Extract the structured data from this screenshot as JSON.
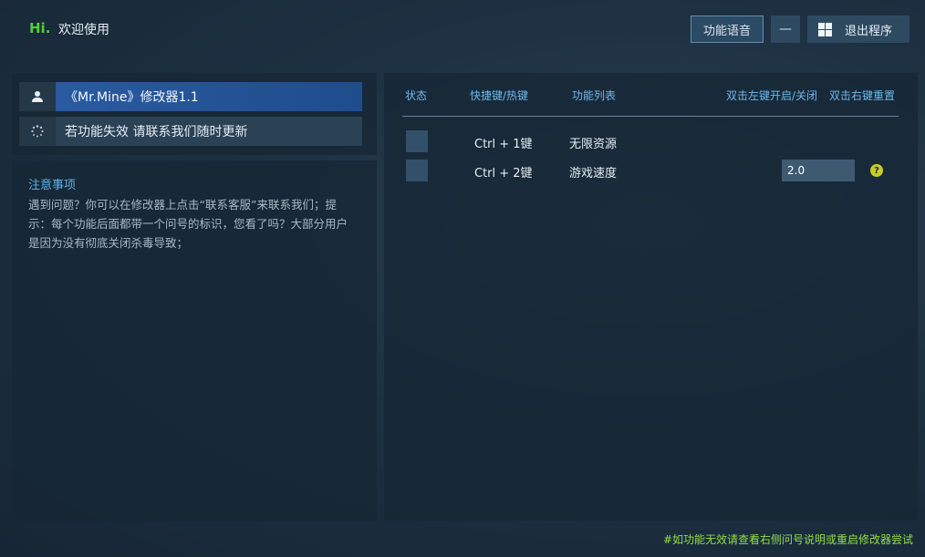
{
  "header": {
    "hi": "Hi.",
    "welcome": "欢迎使用",
    "voice_button": "功能语音",
    "minimize_label": "—",
    "exit_button": "退出程序"
  },
  "left_panel": {
    "game_title": "《Mr.Mine》修改器1.1",
    "status_message": "若功能失效  请联系我们随时更新",
    "notice_title": "注意事项",
    "notice_body": "遇到问题？你可以在修改器上点击“联系客服”来联系我们；提示：每个功能后面都带一个问号的标识，您看了吗？大部分用户是因为没有彻底关闭杀毒导致；"
  },
  "table": {
    "headers": {
      "status": "状态",
      "hotkey": "快捷键/热键",
      "function": "功能列表",
      "left_toggle": "双击左键开启/关闭",
      "right_reset": "双击右键重置"
    },
    "rows": [
      {
        "hotkey": "Ctrl  +  1键",
        "function": "无限资源"
      },
      {
        "hotkey": "Ctrl  +  2键",
        "function": "游戏速度",
        "value": "2.0",
        "help": "?"
      }
    ]
  },
  "footer": "#如功能无效请查看右侧问号说明或重启修改器尝试",
  "colors": {
    "accent_green": "#4cd137",
    "header_blue": "#6db8ec",
    "selected_row": "#2a5aa0",
    "footer_green": "#8edd4a",
    "help_yellow": "#c8cc2a"
  }
}
